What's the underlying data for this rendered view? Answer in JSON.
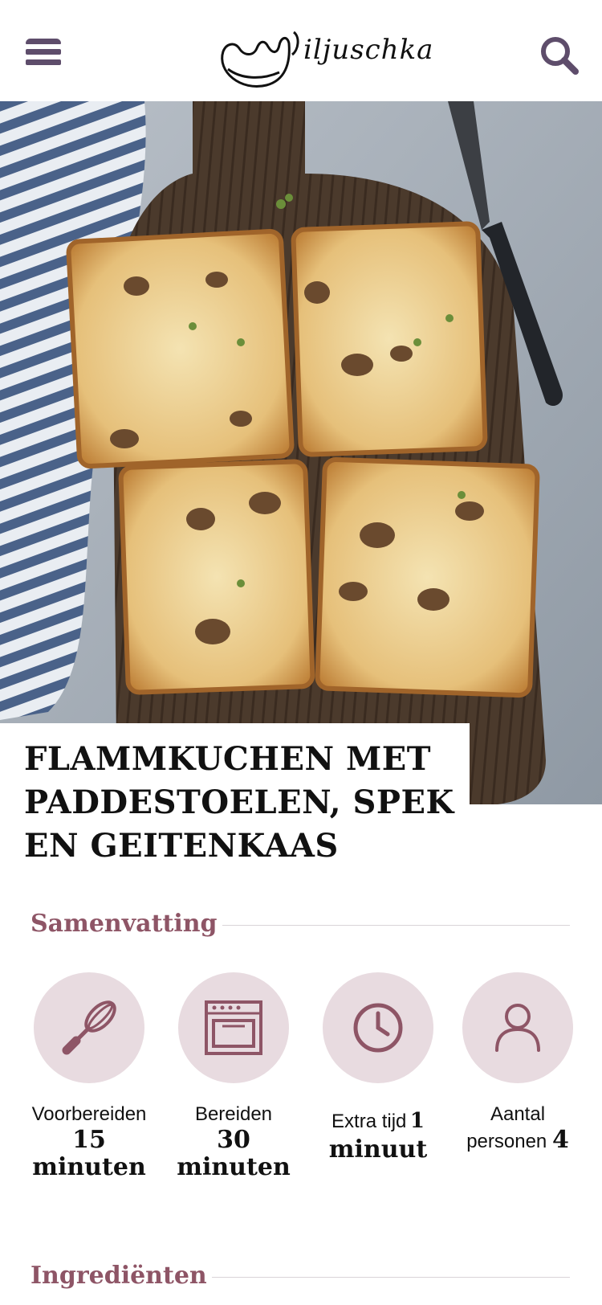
{
  "header": {
    "menu_icon": "hamburger-menu-icon",
    "logo_text": "iljuschka",
    "search_icon": "search-icon"
  },
  "hero": {
    "image": "flammkuchen-on-wooden-board-photo"
  },
  "recipe": {
    "title": "FLAMMKUCHEN MET PADDESTOELEN, SPEK EN GEITENKAAS"
  },
  "summary": {
    "heading": "Samenvatting",
    "items": [
      {
        "icon": "whisk-icon",
        "label": "Voorbereiden",
        "value": "15 minuten"
      },
      {
        "icon": "oven-icon",
        "label": "Bereiden",
        "value": "30 minuten"
      },
      {
        "icon": "clock-icon",
        "label": "Extra tijd",
        "value_inline": "1",
        "value": "minuut"
      },
      {
        "icon": "person-icon",
        "label": "Aantal personen",
        "value_inline": "4"
      }
    ]
  },
  "ingredients": {
    "heading": "Ingrediënten"
  },
  "colors": {
    "accent": "#8e5566",
    "icon": "#8e5566",
    "circle": "#e8dbe0",
    "menu": "#5e4d6b"
  }
}
